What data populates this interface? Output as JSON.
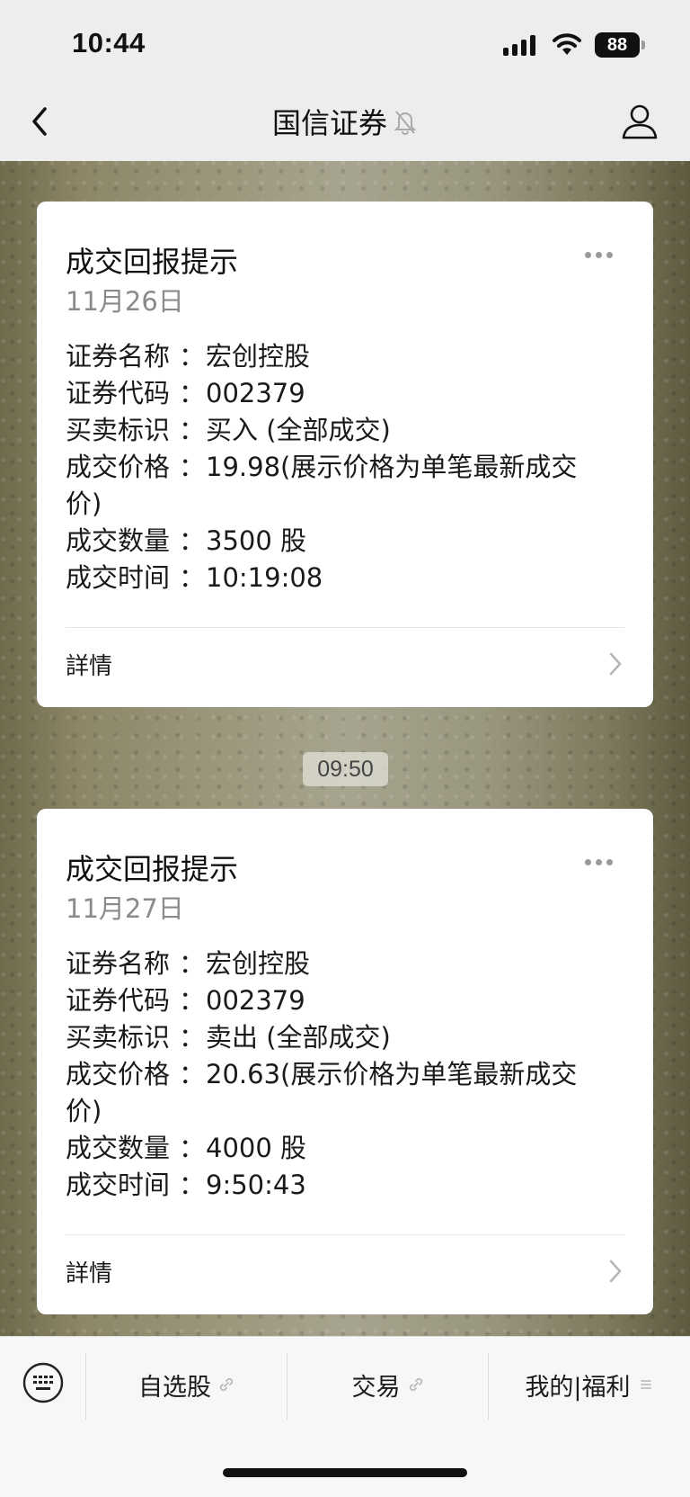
{
  "status_bar": {
    "time": "10:44",
    "battery": "88"
  },
  "nav": {
    "title": "国信证券"
  },
  "messages": [
    {
      "title": "成交回报提示",
      "date": "11月26日",
      "rows": [
        {
          "label": "证券名称",
          "value": "宏创控股"
        },
        {
          "label": "证券代码",
          "value": "002379"
        },
        {
          "label": "买卖标识",
          "value": "买入 (全部成交)"
        },
        {
          "label": "成交价格",
          "value": "19.98(展示价格为单笔最新成交",
          "tail": "价)"
        },
        {
          "label": "成交数量",
          "value": "3500 股"
        },
        {
          "label": "成交时间",
          "value": "10:19:08"
        }
      ],
      "detail": "詳情"
    },
    {
      "title": "成交回报提示",
      "date": "11月27日",
      "rows": [
        {
          "label": "证券名称",
          "value": "宏创控股"
        },
        {
          "label": "证券代码",
          "value": "002379"
        },
        {
          "label": "买卖标识",
          "value": "卖出 (全部成交)"
        },
        {
          "label": "成交价格",
          "value": "20.63(展示价格为单笔最新成交",
          "tail": "价)"
        },
        {
          "label": "成交数量",
          "value": "4000 股"
        },
        {
          "label": "成交时间",
          "value": "9:50:43"
        }
      ],
      "detail": "詳情"
    }
  ],
  "timestamp": "09:50",
  "colon": "：",
  "bottom_menu": {
    "items": [
      "自选股",
      "交易",
      "我的|福利"
    ]
  }
}
